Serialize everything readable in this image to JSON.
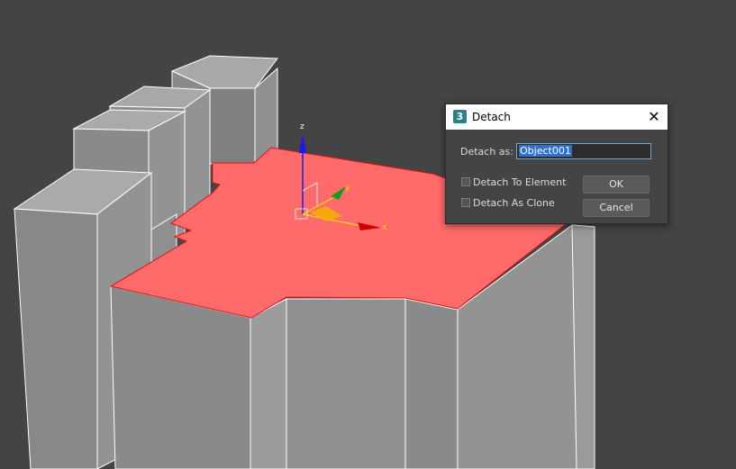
{
  "dialog": {
    "title": "Detach",
    "app_icon_label": "3",
    "close_glyph": "✕",
    "detach_as_label": "Detach as:",
    "detach_as_value": "Object001",
    "detach_to_element_label": "Detach To Element",
    "detach_as_clone_label": "Detach As Clone",
    "ok_label": "OK",
    "cancel_label": "Cancel"
  },
  "viewport": {
    "gizmo_axes": {
      "x": "x",
      "y": "y",
      "z": "z"
    },
    "colors": {
      "background": "#444444",
      "selected_face": "#ff6b6b",
      "geometry": "#999999",
      "x_axis": "#cc0000",
      "y_axis": "#1a9a1a",
      "z_axis": "#1a1aee"
    }
  }
}
